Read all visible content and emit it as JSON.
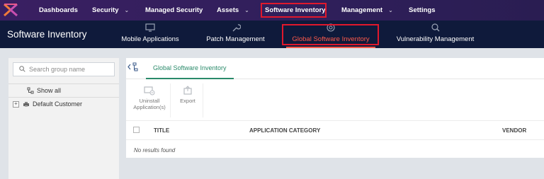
{
  "topnav": {
    "items": [
      {
        "label": "Dashboards"
      },
      {
        "label": "Security"
      },
      {
        "label": "Managed Security"
      },
      {
        "label": "Assets"
      },
      {
        "label": "Software Inventory"
      },
      {
        "label": "Management"
      },
      {
        "label": "Settings"
      }
    ]
  },
  "subnav": {
    "title": "Software Inventory",
    "tabs": [
      {
        "label": "Mobile Applications",
        "icon": "monitor-icon"
      },
      {
        "label": "Patch Management",
        "icon": "wrench-icon"
      },
      {
        "label": "Global Software Inventory",
        "icon": "globe-icon"
      },
      {
        "label": "Vulnerability Management",
        "icon": "search-bug-icon"
      }
    ]
  },
  "leftpanel": {
    "search_placeholder": "Search group name",
    "show_all": "Show all",
    "tree": [
      {
        "label": "Default Customer"
      }
    ]
  },
  "main": {
    "tab": "Global Software Inventory",
    "toolbar": {
      "uninstall": "Uninstall Application(s)",
      "export": "Export"
    },
    "columns": [
      "TITLE",
      "APPLICATION CATEGORY",
      "VENDOR"
    ],
    "empty_text": "No results found"
  },
  "colors": {
    "topnav_bg": "#3a1f62",
    "subnav_bg": "#0f1a3b",
    "active_accent": "#ff5a4a",
    "highlight_box": "#e0182c",
    "tab_accent": "#2a8a6a"
  }
}
